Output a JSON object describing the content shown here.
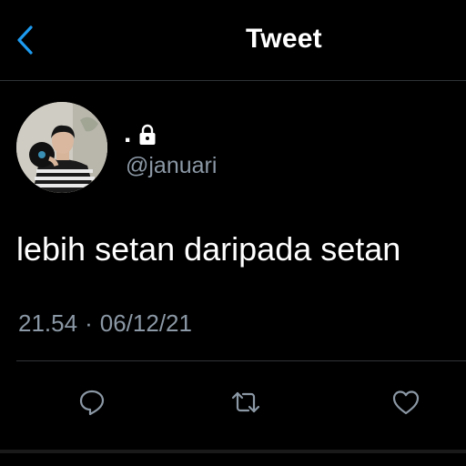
{
  "header": {
    "title": "Tweet",
    "back_icon": "chevron-left-icon"
  },
  "tweet": {
    "author": {
      "display_name": ".",
      "protected_icon": "lock-icon",
      "handle": "@januari"
    },
    "text": "lebih setan daripada setan",
    "time": "21.54",
    "separator": "·",
    "date": "06/12/21"
  },
  "actions": [
    {
      "name": "reply",
      "icon": "reply-icon"
    },
    {
      "name": "retweet",
      "icon": "retweet-icon"
    },
    {
      "name": "like",
      "icon": "heart-icon"
    }
  ],
  "colors": {
    "background": "#000000",
    "accent": "#1d9bf0",
    "text_primary": "#ffffff",
    "text_secondary": "#8b98a5",
    "divider": "#2f3336"
  }
}
